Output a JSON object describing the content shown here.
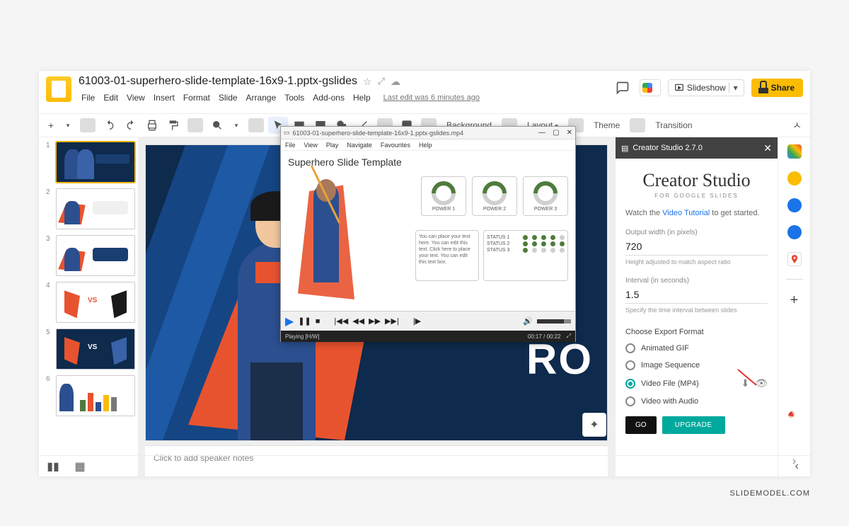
{
  "header": {
    "doc_title": "61003-01-superhero-slide-template-16x9-1.pptx-gslides",
    "menubar": [
      "File",
      "Edit",
      "View",
      "Insert",
      "Format",
      "Slide",
      "Arrange",
      "Tools",
      "Add-ons",
      "Help"
    ],
    "last_edit": "Last edit was 6 minutes ago",
    "slideshow_label": "Slideshow",
    "share_label": "Share"
  },
  "toolbar": {
    "background": "Background",
    "layout": "Layout",
    "theme": "Theme",
    "transition": "Transition"
  },
  "thumbnails": [
    {
      "n": "1",
      "sel": true
    },
    {
      "n": "2"
    },
    {
      "n": "3"
    },
    {
      "n": "4"
    },
    {
      "n": "5"
    },
    {
      "n": "6"
    }
  ],
  "canvas": {
    "slide_title": "RO",
    "speaker_placeholder": "Click to add speaker notes"
  },
  "player": {
    "window_title": "61003-01-superhero-slide-template-16x9-1.pptx-gslides.mp4",
    "menu": [
      "File",
      "View",
      "Play",
      "Navigate",
      "Favourites",
      "Help"
    ],
    "video_title": "Superhero Slide Template",
    "powers": [
      "POWER 1",
      "POWER 2",
      "POWER 3"
    ],
    "textbox": "You can place your text here. You can edit this text.\n\nClick here to place your text. You can edit this text box.",
    "status_rows": [
      "STATUS 1",
      "STATUS 2",
      "STATUS 3"
    ],
    "status_label": "Playing [H/W]",
    "time": "00:17 / 00:22"
  },
  "addon": {
    "title": "Creator Studio 2.7.0",
    "brand": "Creator Studio",
    "brand_sub": "FOR GOOGLE SLIDES",
    "watch_pre": "Watch the ",
    "watch_link": "Video Tutorial",
    "watch_post": " to get started.",
    "width_label": "Output width (in pixels)",
    "width_value": "720",
    "width_hint": "Height adjusted to match aspect ratio",
    "interval_label": "Interval (in seconds)",
    "interval_value": "1.5",
    "interval_hint": "Specify the time interval between slides",
    "format_label": "Choose Export Format",
    "formats": [
      "Animated GIF",
      "Image Sequence",
      "Video File (MP4)",
      "Video with Audio"
    ],
    "go": "GO",
    "upgrade": "UPGRADE"
  },
  "watermark": "SLIDEMODEL.COM"
}
